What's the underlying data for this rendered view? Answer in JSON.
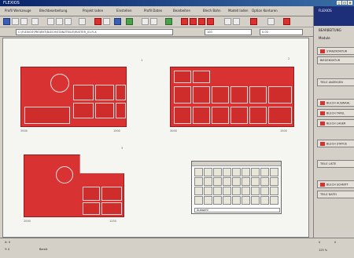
{
  "window": {
    "title": "FLEXIOS"
  },
  "menu": {
    "items": [
      "Profil Werkzeuge",
      "Blechbearbeitung",
      "Projekt laden",
      "Einstellen",
      "Profil Daten",
      "Bearbeiten",
      "Blech Bahn",
      "Modell laden",
      "Option Konturen"
    ]
  },
  "addressbar": {
    "path": "C:\\FLEXIOS\\PROJEKT\\BLECH\\STANZTEILE\\MUSTER_01.FLX",
    "field2": "100",
    "field3": "0.00"
  },
  "sidebar": {
    "header_title": "FLEXIOS",
    "header_sub": "BEARBEITUNG",
    "section_label": "Module",
    "items": [
      {
        "label": "STANZKONTUR",
        "swatch": true
      },
      {
        "label": "BIEGEKONTUR",
        "swatch": false
      },
      {
        "label": "TEILE ANZEIGEN",
        "swatch": false
      },
      {
        "label": "BLECH AUSWAHL",
        "swatch": true
      },
      {
        "label": "BLECH TAFEL",
        "swatch": true
      },
      {
        "label": "BLECH LAGER",
        "swatch": true
      },
      {
        "label": "BLECH STATUS",
        "swatch": true
      },
      {
        "label": "TEILE LISTE",
        "swatch": false
      },
      {
        "label": "BLECH SCHNITT",
        "swatch": true
      },
      {
        "label": "TEILE DATEI",
        "swatch": false
      }
    ]
  },
  "canvas": {
    "dim_labels": [
      "3000",
      "1500",
      "3000",
      "1500",
      "2000",
      "1250"
    ],
    "plate_numbers": [
      "1",
      "2",
      "3"
    ]
  },
  "palette": {
    "bar_text": "Auswahl"
  },
  "status": {
    "left": [
      "X: 0",
      "Y: 0"
    ],
    "mid": "Bereit",
    "right": [
      "0",
      "0",
      "125 %"
    ]
  },
  "colors": {
    "plate": "#d93232",
    "accent": "#1e2f7a",
    "chrome": "#d4d0c8"
  }
}
